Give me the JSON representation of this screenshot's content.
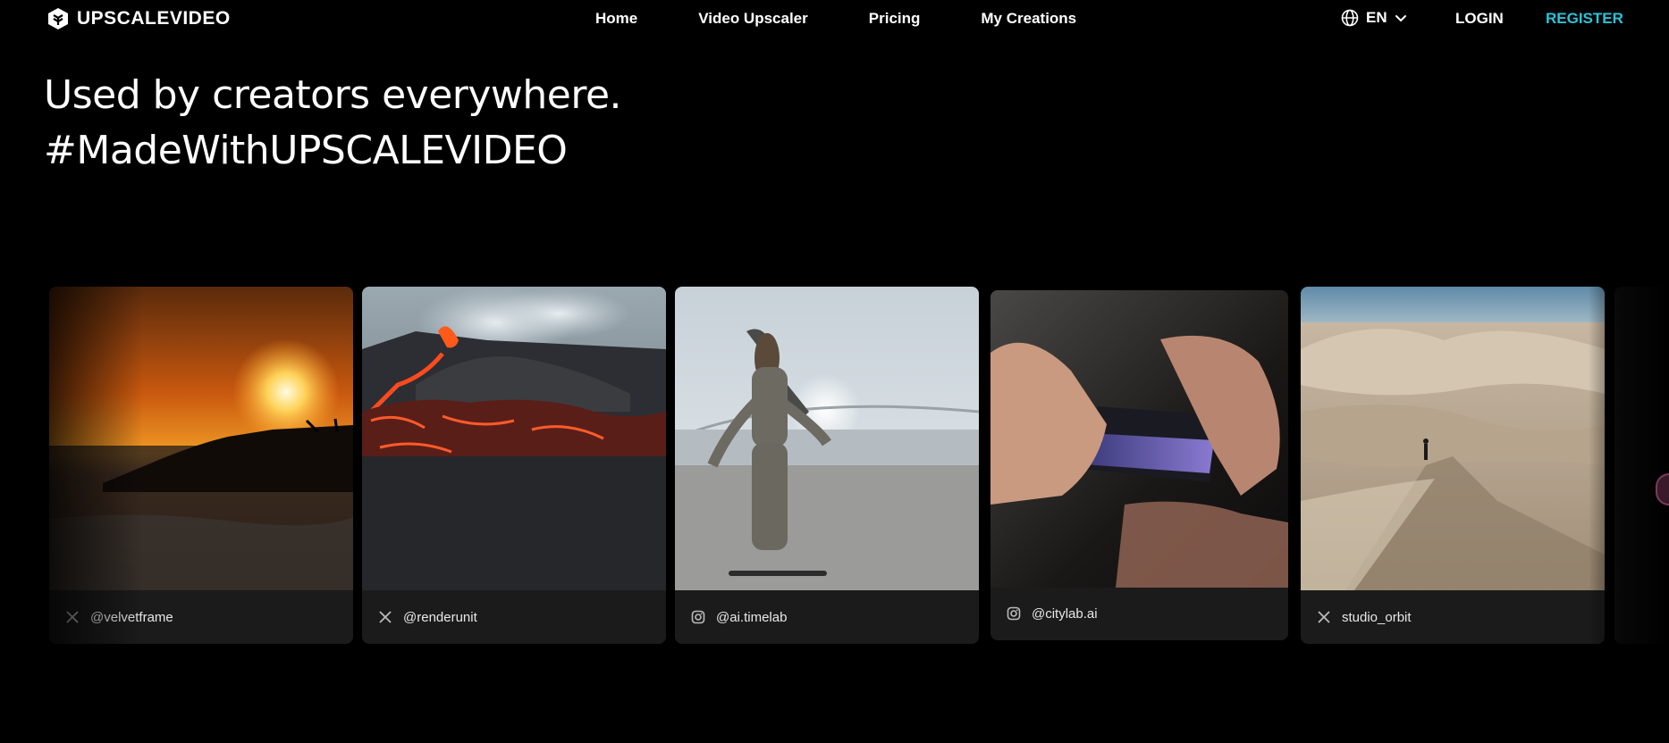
{
  "header": {
    "logo_text": "UPSCALEVIDEO",
    "nav": [
      "Home",
      "Video Upscaler",
      "Pricing",
      "My Creations"
    ],
    "language": "EN",
    "login": "LOGIN",
    "register": "REGISTER"
  },
  "hero": {
    "line1": "Used by creators everywhere.",
    "line2": "#MadeWithUPSCALEVIDEO"
  },
  "gallery": {
    "cards": [
      {
        "handle": "@velvetframe",
        "platform": "x-icon",
        "scene": "sunset over rocky shore with fishermen"
      },
      {
        "handle": "@renderunit",
        "platform": "x-icon",
        "scene": "erupting volcano with lava flow"
      },
      {
        "handle": "@ai.timelab",
        "platform": "instagram-icon",
        "scene": "girl on skateboard backlit by sun"
      },
      {
        "handle": "@citylab.ai",
        "platform": "instagram-icon",
        "scene": "hands holding smartphone"
      },
      {
        "handle": "studio_orbit",
        "platform": "x-icon",
        "scene": "person standing on desert sand dunes"
      }
    ]
  },
  "colors": {
    "accent": "#28c4d9",
    "background": "#000000",
    "card": "#1b1b1b"
  }
}
